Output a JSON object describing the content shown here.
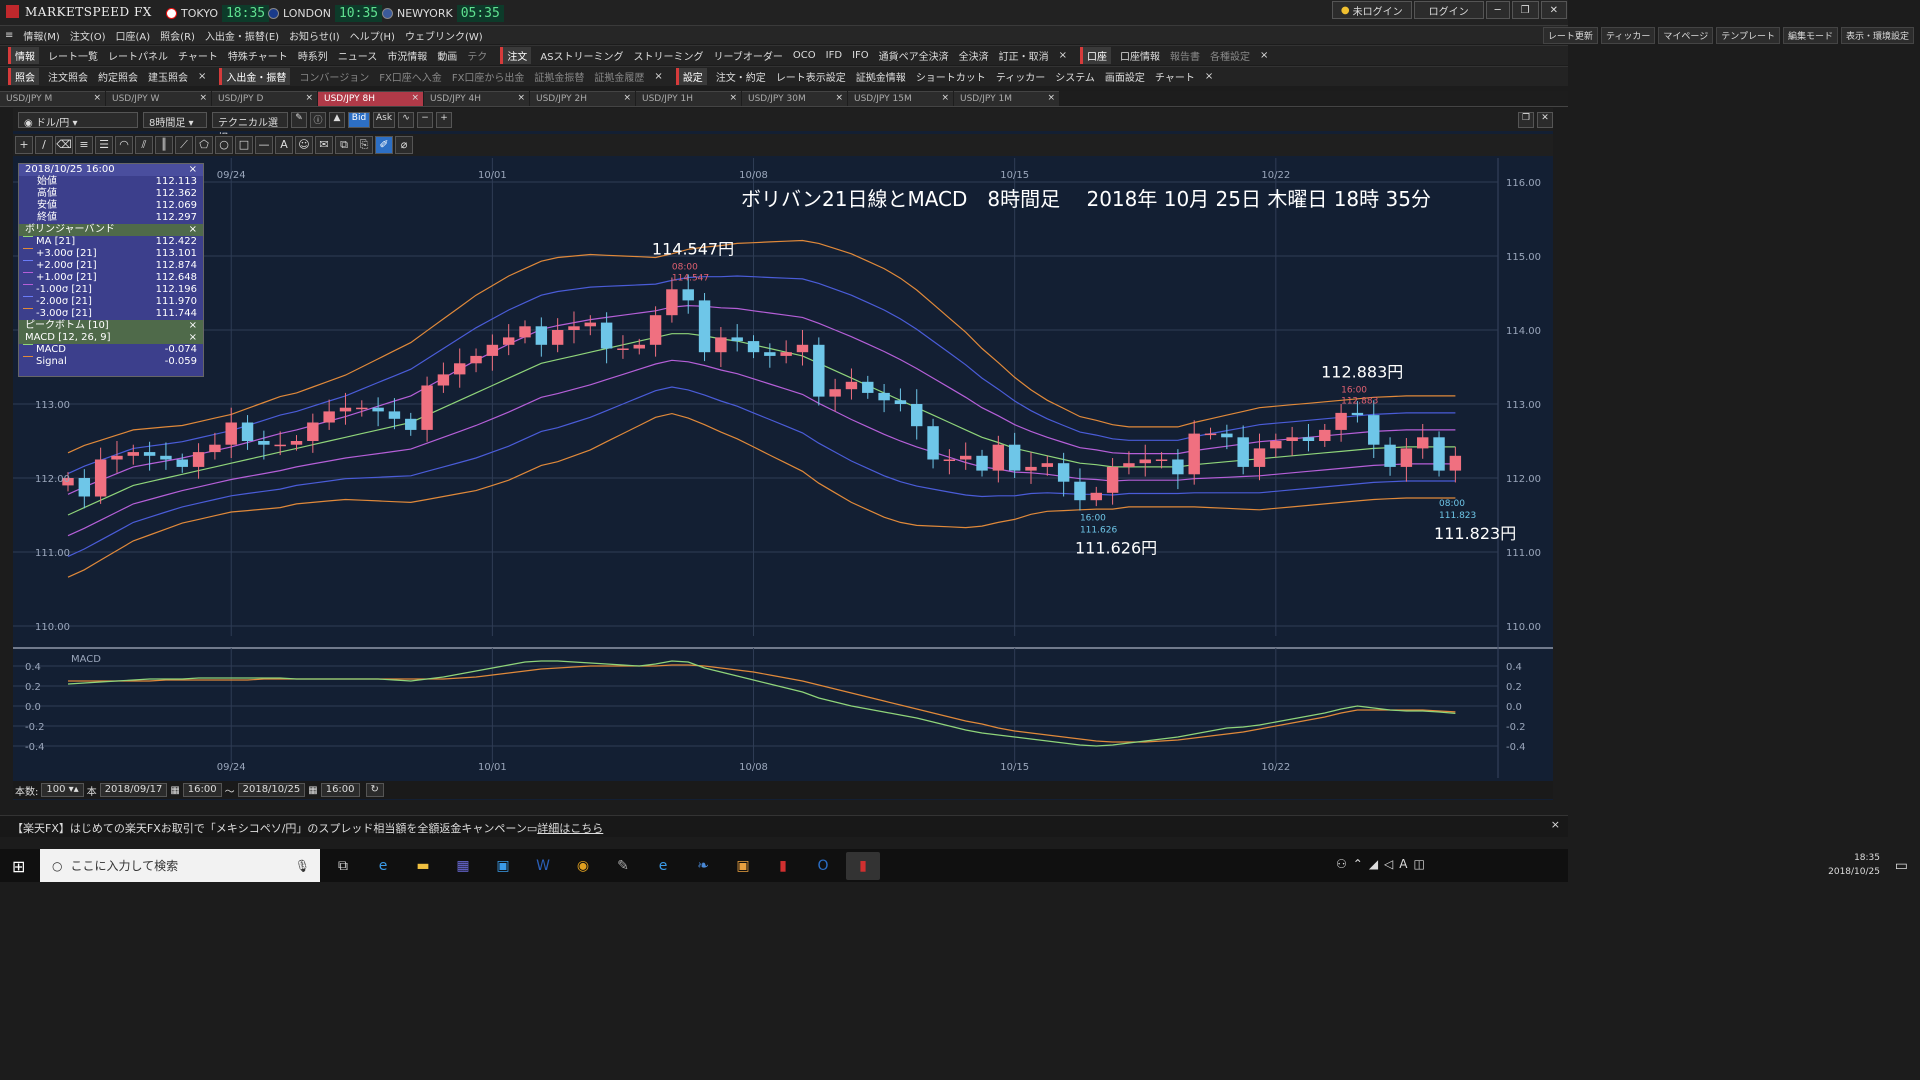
{
  "app": {
    "logo": "MARKETSPEED FX"
  },
  "clocks": [
    {
      "city": "TOKYO",
      "time": "18:35",
      "flag": "#e11"
    },
    {
      "city": "LONDON",
      "time": "10:35",
      "flag": "#1a3b8a"
    },
    {
      "city": "NEWYORK",
      "time": "05:35",
      "flag": "#3b5a9a"
    }
  ],
  "titlebar": {
    "login_status": "未ログイン",
    "login_btn": "ログイン"
  },
  "menu": [
    "情報(M)",
    "注文(O)",
    "口座(A)",
    "照会(R)",
    "入出金・振替(E)",
    "お知らせ(I)",
    "ヘルプ(H)",
    "ウェブリンク(W)"
  ],
  "right_menu": [
    "レート更新",
    "ティッカー",
    "マイページ",
    "テンプレート",
    "編集モード",
    "表示・環境設定"
  ],
  "toolrow1": {
    "section": "情報",
    "items": [
      "レート一覧",
      "レートパネル",
      "チャート",
      "特殊チャート",
      "時系列",
      "ニュース",
      "市況情報",
      "動画",
      "テク"
    ],
    "section2": "注文",
    "items2": [
      "ASストリーミング",
      "ストリーミング",
      "リーブオーダー",
      "OCO",
      "IFD",
      "IFO",
      "通貨ペア全決済",
      "全決済",
      "訂正・取消"
    ],
    "section3": "口座",
    "items3": [
      "口座情報",
      "報告書",
      "各種設定"
    ]
  },
  "toolrow2": {
    "section": "照会",
    "items": [
      "注文照会",
      "約定照会",
      "建玉照会"
    ],
    "section2": "入出金・振替",
    "items2": [
      "コンバージョン",
      "FX口座へ入金",
      "FX口座から出金",
      "証拠金振替",
      "証拠金履歴"
    ],
    "section3": "設定",
    "items3": [
      "注文・約定",
      "レート表示設定",
      "証拠金情報",
      "ショートカット",
      "ティッカー",
      "システム",
      "画面設定",
      "チャート"
    ]
  },
  "tabs": [
    {
      "label": "USD/JPY M"
    },
    {
      "label": "USD/JPY W"
    },
    {
      "label": "USD/JPY D"
    },
    {
      "label": "USD/JPY 8H",
      "active": true
    },
    {
      "label": "USD/JPY 4H"
    },
    {
      "label": "USD/JPY 2H"
    },
    {
      "label": "USD/JPY 1H"
    },
    {
      "label": "USD/JPY 30M"
    },
    {
      "label": "USD/JPY 15M"
    },
    {
      "label": "USD/JPY 1M"
    }
  ],
  "chart_controls": {
    "pair": "ドル/円",
    "timeframe": "8時間足",
    "technical": "テクニカル選択",
    "bid": "Bid",
    "ask": "Ask"
  },
  "info": {
    "date": "2018/10/25 16:00",
    "ohlc": [
      {
        "k": "始値",
        "v": "112.113"
      },
      {
        "k": "高値",
        "v": "112.362"
      },
      {
        "k": "安値",
        "v": "112.069"
      },
      {
        "k": "終値",
        "v": "112.297"
      }
    ],
    "bb_title": "ボリンジャーバンド",
    "bb": [
      {
        "k": "MA [21]",
        "v": "112.422",
        "c": "#8fd47a"
      },
      {
        "k": "+3.00σ [21]",
        "v": "113.101",
        "c": "#e0893a"
      },
      {
        "k": "+2.00σ [21]",
        "v": "112.874",
        "c": "#4a5cd8"
      },
      {
        "k": "+1.00σ [21]",
        "v": "112.648",
        "c": "#b55fd8"
      },
      {
        "k": "-1.00σ [21]",
        "v": "112.196",
        "c": "#b55fd8"
      },
      {
        "k": "-2.00σ [21]",
        "v": "111.970",
        "c": "#4a5cd8"
      },
      {
        "k": "-3.00σ [21]",
        "v": "111.744",
        "c": "#e0893a"
      }
    ],
    "pb_title": "ピークボトム [10]",
    "macd_title": "MACD [12, 26, 9]",
    "macd": [
      {
        "k": "MACD",
        "v": "-0.074",
        "c": "#8fd47a"
      },
      {
        "k": "Signal",
        "v": "-0.059",
        "c": "#e0893a"
      }
    ]
  },
  "chart_data": {
    "type": "candlestick",
    "title": "ボリバン21日線とMACD　8時間足　 2018年 10月 25日 木曜日 18時 35分",
    "xticks": [
      "09/24",
      "10/01",
      "10/08",
      "10/15",
      "10/22"
    ],
    "yticks": [
      "116.00",
      "115.00",
      "114.00",
      "113.00",
      "112.00",
      "111.00",
      "110.00"
    ],
    "ylim": [
      110,
      116
    ],
    "annotations": [
      {
        "text": "114.547円",
        "time": "08:00",
        "price": "114.547",
        "color": "#e06070"
      },
      {
        "text": "112.883円",
        "time": "16:00",
        "price": "112.883",
        "color": "#e06070"
      },
      {
        "text": "111.626円",
        "time": "16:00",
        "price": "111.626",
        "color": "#6ec6e8"
      },
      {
        "text": "111.823円",
        "time": "08:00",
        "price": "111.823",
        "color": "#6ec6e8"
      }
    ],
    "macd_label": "MACD",
    "macd_yticks": [
      "0.4",
      "0.2",
      "0.0",
      "-0.2",
      "-0.4"
    ],
    "macd_ylim": [
      -0.5,
      0.5
    ],
    "closes": [
      112.0,
      111.75,
      112.25,
      112.3,
      112.35,
      112.3,
      112.25,
      112.15,
      112.35,
      112.45,
      112.75,
      112.5,
      112.45,
      112.45,
      112.5,
      112.75,
      112.9,
      112.95,
      112.95,
      112.9,
      112.8,
      112.65,
      113.25,
      113.4,
      113.55,
      113.65,
      113.8,
      113.9,
      114.05,
      113.8,
      114.0,
      114.05,
      114.1,
      113.75,
      113.75,
      113.8,
      114.2,
      114.55,
      114.4,
      113.7,
      113.9,
      113.85,
      113.7,
      113.65,
      113.7,
      113.8,
      113.1,
      113.2,
      113.3,
      113.15,
      113.05,
      113.0,
      112.7,
      112.25,
      112.25,
      112.3,
      112.1,
      112.45,
      112.1,
      112.15,
      112.2,
      111.95,
      111.7,
      111.8,
      112.15,
      112.2,
      112.25,
      112.25,
      112.05,
      112.6,
      112.6,
      112.55,
      112.15,
      112.4,
      112.5,
      112.55,
      112.5,
      112.65,
      112.88,
      112.85,
      112.45,
      112.15,
      112.4,
      112.55,
      112.1,
      112.3
    ],
    "bb_mid": [
      111.5,
      111.6,
      111.7,
      111.8,
      111.9,
      111.95,
      112.0,
      112.05,
      112.1,
      112.15,
      112.2,
      112.25,
      112.3,
      112.35,
      112.4,
      112.45,
      112.5,
      112.55,
      112.6,
      112.65,
      112.7,
      112.75,
      112.85,
      112.95,
      113.05,
      113.15,
      113.25,
      113.35,
      113.45,
      113.55,
      113.6,
      113.65,
      113.7,
      113.75,
      113.8,
      113.85,
      113.9,
      113.95,
      113.95,
      113.92,
      113.88,
      113.85,
      113.8,
      113.75,
      113.7,
      113.65,
      113.55,
      113.45,
      113.35,
      113.25,
      113.15,
      113.05,
      112.95,
      112.85,
      112.75,
      112.65,
      112.55,
      112.48,
      112.4,
      112.35,
      112.3,
      112.25,
      112.2,
      112.18,
      112.15,
      112.15,
      112.15,
      112.15,
      112.15,
      112.18,
      112.2,
      112.22,
      112.24,
      112.26,
      112.28,
      112.3,
      112.32,
      112.34,
      112.36,
      112.38,
      112.4,
      112.41,
      112.42,
      112.42,
      112.42,
      112.42
    ],
    "bb_w1": [
      0.28,
      0.28,
      0.27,
      0.26,
      0.25,
      0.24,
      0.23,
      0.22,
      0.22,
      0.22,
      0.22,
      0.23,
      0.24,
      0.25,
      0.25,
      0.26,
      0.27,
      0.28,
      0.3,
      0.32,
      0.34,
      0.36,
      0.38,
      0.4,
      0.42,
      0.44,
      0.45,
      0.46,
      0.46,
      0.46,
      0.46,
      0.45,
      0.44,
      0.42,
      0.4,
      0.38,
      0.36,
      0.36,
      0.38,
      0.4,
      0.42,
      0.44,
      0.46,
      0.48,
      0.5,
      0.52,
      0.54,
      0.55,
      0.56,
      0.56,
      0.56,
      0.55,
      0.53,
      0.5,
      0.47,
      0.44,
      0.4,
      0.36,
      0.32,
      0.28,
      0.25,
      0.23,
      0.21,
      0.2,
      0.19,
      0.18,
      0.18,
      0.18,
      0.18,
      0.19,
      0.2,
      0.21,
      0.22,
      0.23,
      0.23,
      0.23,
      0.23,
      0.23,
      0.23,
      0.23,
      0.23,
      0.23,
      0.23,
      0.23,
      0.23,
      0.23
    ],
    "macd_line": [
      0.22,
      0.23,
      0.24,
      0.25,
      0.26,
      0.27,
      0.27,
      0.27,
      0.28,
      0.28,
      0.28,
      0.28,
      0.28,
      0.28,
      0.27,
      0.27,
      0.27,
      0.27,
      0.27,
      0.27,
      0.26,
      0.25,
      0.27,
      0.29,
      0.32,
      0.35,
      0.38,
      0.41,
      0.44,
      0.45,
      0.45,
      0.44,
      0.43,
      0.42,
      0.41,
      0.4,
      0.42,
      0.45,
      0.44,
      0.38,
      0.34,
      0.3,
      0.26,
      0.22,
      0.18,
      0.14,
      0.08,
      0.04,
      0.0,
      -0.03,
      -0.06,
      -0.09,
      -0.12,
      -0.16,
      -0.2,
      -0.24,
      -0.27,
      -0.29,
      -0.31,
      -0.33,
      -0.35,
      -0.37,
      -0.39,
      -0.4,
      -0.39,
      -0.37,
      -0.35,
      -0.33,
      -0.31,
      -0.28,
      -0.25,
      -0.22,
      -0.21,
      -0.19,
      -0.16,
      -0.13,
      -0.1,
      -0.07,
      -0.03,
      0.0,
      -0.02,
      -0.04,
      -0.05,
      -0.05,
      -0.06,
      -0.074
    ],
    "signal_line": [
      0.25,
      0.25,
      0.25,
      0.25,
      0.25,
      0.25,
      0.26,
      0.26,
      0.26,
      0.26,
      0.26,
      0.26,
      0.27,
      0.27,
      0.27,
      0.27,
      0.27,
      0.27,
      0.27,
      0.27,
      0.27,
      0.27,
      0.27,
      0.27,
      0.28,
      0.29,
      0.31,
      0.33,
      0.35,
      0.37,
      0.38,
      0.39,
      0.4,
      0.4,
      0.4,
      0.4,
      0.4,
      0.41,
      0.41,
      0.4,
      0.38,
      0.36,
      0.34,
      0.31,
      0.28,
      0.25,
      0.21,
      0.17,
      0.13,
      0.09,
      0.05,
      0.01,
      -0.03,
      -0.07,
      -0.11,
      -0.15,
      -0.18,
      -0.22,
      -0.25,
      -0.27,
      -0.29,
      -0.31,
      -0.33,
      -0.35,
      -0.36,
      -0.36,
      -0.36,
      -0.35,
      -0.34,
      -0.32,
      -0.3,
      -0.28,
      -0.26,
      -0.23,
      -0.2,
      -0.17,
      -0.14,
      -0.11,
      -0.07,
      -0.04,
      -0.04,
      -0.04,
      -0.04,
      -0.04,
      -0.05,
      -0.059
    ]
  },
  "bottom": {
    "count_label": "本数:",
    "count": "100",
    "unit": "本",
    "from_date": "2018/09/17",
    "from_time": "16:00",
    "tilde": "～",
    "to_date": "2018/10/25",
    "to_time": "16:00"
  },
  "news": "【楽天FX】はじめての楽天FXお取引で「メキシコペソ/円」のスプレッド相当額を全額返金キャンペーン",
  "news_link": "詳細はこちら",
  "taskbar": {
    "search_placeholder": "ここに入力して検索",
    "time": "18:35",
    "date": "2018/10/25"
  }
}
